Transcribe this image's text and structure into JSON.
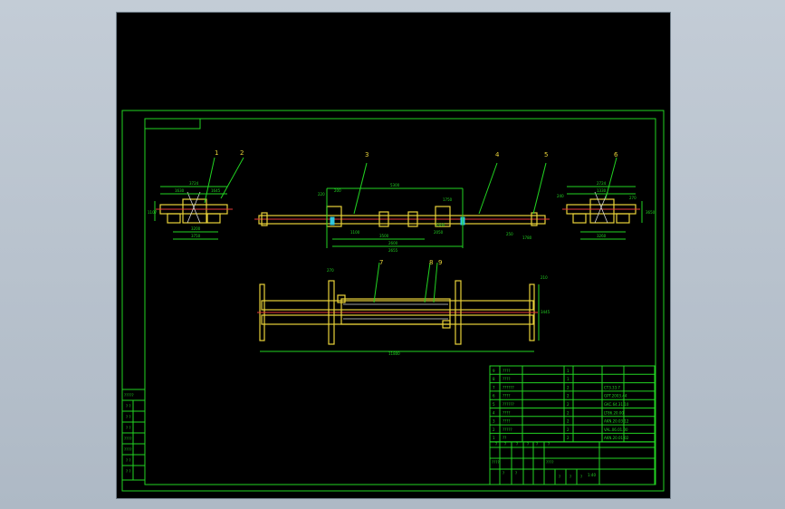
{
  "drawing": {
    "part_labels": [
      "1",
      "2",
      "3",
      "4",
      "5",
      "6",
      "7",
      "8",
      "9"
    ],
    "dimensions": {
      "view1": [
        "3724",
        "1630",
        "1645",
        "1107",
        "3200",
        "3750"
      ],
      "view2": [
        "5300",
        "220",
        "200",
        "1750",
        "3500",
        "2600",
        "2050",
        "1100",
        "3300",
        "2655",
        "250",
        "1780"
      ],
      "view3": [
        "2724",
        "1330",
        "240",
        "3650",
        "270",
        "3260"
      ],
      "plan": [
        "270",
        "210",
        "11800",
        "3445"
      ]
    },
    "title_block": {
      "bom_rows": [
        {
          "no": "9",
          "name": "????",
          "qty": "1",
          "code": ""
        },
        {
          "no": "8",
          "name": "????",
          "qty": "1",
          "code": ""
        },
        {
          "no": "7",
          "name": "??????",
          "qty": "2",
          "code": "CT3.33.7"
        },
        {
          "no": "6",
          "name": "????",
          "qty": "2",
          "code": "GPT.2003.44"
        },
        {
          "no": "5",
          "name": "??????",
          "qty": "2",
          "code": "GKC.64.31.10"
        },
        {
          "no": "4",
          "name": "????",
          "qty": "2",
          "code": "LT86.20.00"
        },
        {
          "no": "3",
          "name": "????",
          "qty": "2",
          "code": "AKN.20.03.12"
        },
        {
          "no": "2",
          "name": "?????",
          "qty": "2",
          "code": "VAL.06.01.00"
        },
        {
          "no": "1",
          "name": "??",
          "qty": "2",
          "code": "AKN.20.01.02"
        }
      ],
      "header": [
        "?",
        "?",
        "?",
        "?",
        "?",
        "?"
      ],
      "cells": [
        "????",
        "?",
        "?",
        "????",
        "?",
        "?",
        "?"
      ],
      "scale": "1:40"
    },
    "side_table": [
      "?????",
      "? ?",
      "? ?",
      "? ?",
      "????",
      "????",
      "? ?",
      "? ?"
    ]
  }
}
